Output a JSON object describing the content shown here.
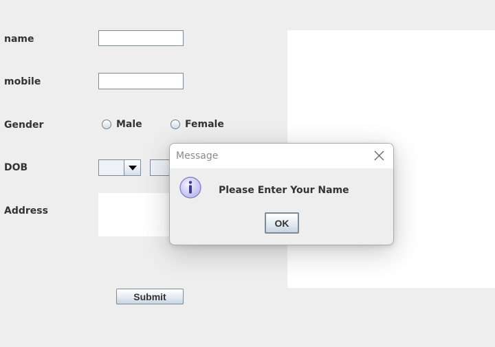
{
  "form": {
    "name_label": "name",
    "name_value": "",
    "mobile_label": "mobile",
    "mobile_value": "",
    "gender_label": "Gender",
    "gender_options": [
      "Male",
      "Female"
    ],
    "dob_label": "DOB",
    "dob_day_value": "",
    "dob_month_value": "",
    "address_label": "Address",
    "address_value": "",
    "submit_label": "Submit"
  },
  "dialog": {
    "title": "Message",
    "message": "Please Enter Your Name",
    "ok_label": "OK",
    "icon": "information-icon",
    "close_icon": "close-icon"
  },
  "colors": {
    "window_background": "#eeeeee",
    "field_background": "#ffffff",
    "info_icon_fill": "#c9c7f5",
    "info_icon_glyph": "#3b3b8f"
  }
}
